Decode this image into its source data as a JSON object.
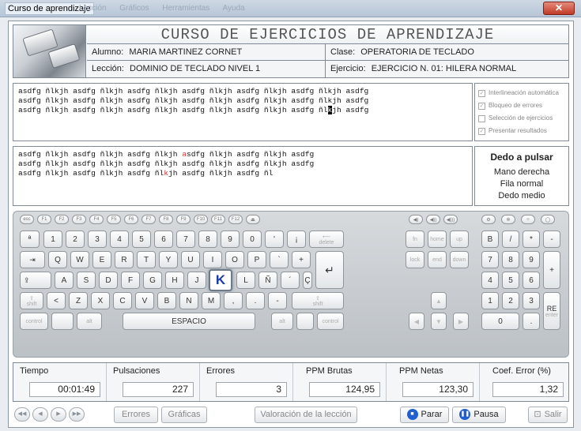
{
  "window": {
    "title": "Curso de aprendizaje",
    "menu_ghost": [
      "Lección",
      "Gráficos",
      "Herramientas",
      "Ayuda"
    ],
    "close_glyph": "✕"
  },
  "header": {
    "course_title": "CURSO DE EJERCICIOS DE APRENDIZAJE",
    "alumno_label": "Alumno:",
    "alumno_value": "MARIA MARTINEZ CORNET",
    "clase_label": "Clase:",
    "clase_value": "OPERATORIA DE TECLADO",
    "leccion_label": "Lección:",
    "leccion_value": "DOMINIO DE TECLADO NIVEL 1",
    "ejercicio_label": "Ejercicio:",
    "ejercicio_value": "EJERCICIO N. 01: HILERA NORMAL"
  },
  "exercise": {
    "lines": [
      "asdfg ñlkjh asdfg ñlkjh asdfg ñlkjh asdfg ñlkjh asdfg ñlkjh asdfg ñlkjh asdfg",
      "asdfg ñlkjh asdfg ñlkjh asdfg ñlkjh asdfg ñlkjh asdfg ñlkjh asdfg ñlkjh asdfg",
      "asdfg ñlkjh asdfg ñlkjh asdfg ñlkjh asdfg ñlkjh asdfg ñlkjh asdfg "
    ],
    "cursor_prefix": "ñl",
    "cursor_char": "k",
    "cursor_suffix": "jh asdfg"
  },
  "typed": {
    "line1_a": "asdfg ñlkjh asdfg ñlkjh asdfg ñlkjh ",
    "line1_err": "a",
    "line1_b": "sdfg ñlkjh asdfg ñlkjh asdfg",
    "line2": "asdfg ñlkjh asdfg ñlkjh asdfg ñlkjh asdfg ñlkjh asdfg ñlkjh asdfg",
    "line3_a": "asdfg ñlkjh asdfg ñlkjh asdfg ñl",
    "line3_err": "k",
    "line3_b": "jh asdfg ñlkjh asdfg ñl"
  },
  "options": [
    {
      "label": "Interlineación automática",
      "checked": true
    },
    {
      "label": "Bloqueo de errores",
      "checked": true
    },
    {
      "label": "Selección de ejercicios",
      "checked": false
    },
    {
      "label": "Presentar resultados",
      "checked": true
    }
  ],
  "hint": {
    "title": "Dedo a pulsar",
    "hand": "Mano derecha",
    "row": "Fila normal",
    "finger": "Dedo medio"
  },
  "keyboard": {
    "fn_row": [
      "esc",
      "F1",
      "F2",
      "F3",
      "F4",
      "F5",
      "F6",
      "F7",
      "F8",
      "F9",
      "F10",
      "F11",
      "F12",
      "⏏"
    ],
    "media_row": [
      "◀)",
      "◀))",
      "◀)))",
      "⚙",
      "✲",
      "☼",
      "◯"
    ],
    "number_row": [
      "ª",
      "1",
      "2",
      "3",
      "4",
      "5",
      "6",
      "7",
      "8",
      "9",
      "0",
      "'",
      "¡"
    ],
    "q_row": [
      "Q",
      "W",
      "E",
      "R",
      "T",
      "Y",
      "U",
      "I",
      "O",
      "P",
      "`",
      "+"
    ],
    "a_row": [
      "A",
      "S",
      "D",
      "F",
      "G",
      "H",
      "J",
      "K",
      "L",
      "Ñ",
      "´",
      "Ç"
    ],
    "z_row": [
      "<",
      "Z",
      "X",
      "C",
      "V",
      "B",
      "N",
      "M",
      ",",
      ".",
      "-"
    ],
    "space_label": "ESPACIO",
    "delete_label": "delete",
    "tab_glyph": "⇥",
    "enter_glyph": "↵",
    "caps_glyph": "⇪",
    "shift_glyph": "⇧",
    "shift_label": "shift",
    "control_label": "control",
    "alt_label": "alt",
    "fn_label": "fn",
    "home_label": "home",
    "up_label": "up",
    "lock_label": "lock",
    "end_label": "end",
    "down_label": "down",
    "up_arrow": "▲",
    "left_arrow": "◀",
    "down_arrow": "▼",
    "right_arrow": "▶",
    "numpad_rows": [
      [
        "B",
        "/",
        "*",
        "-"
      ],
      [
        "7",
        "8",
        "9"
      ],
      [
        "4",
        "5",
        "6"
      ],
      [
        "1",
        "2",
        "3"
      ],
      [
        "0",
        "."
      ]
    ],
    "numpad_plus": "+",
    "numpad_re": "RE",
    "numpad_enter": "enter",
    "active_key": "K"
  },
  "stats": [
    {
      "label": "Tiempo",
      "value": "00:01:49"
    },
    {
      "label": "Pulsaciones",
      "value": "227"
    },
    {
      "label": "Errores",
      "value": "3"
    },
    {
      "label": "PPM Brutas",
      "value": "124,95"
    },
    {
      "label": "PPM Netas",
      "value": "123,30"
    },
    {
      "label": "Coef. Error (%)",
      "value": "1,32"
    }
  ],
  "bottom": {
    "nav_first": "◀◀",
    "nav_prev": "◀",
    "nav_next": "▶",
    "nav_last": "▶▶",
    "errores": "Errores",
    "graficas": "Gráficas",
    "valoracion": "Valoración de la lección",
    "parar": "Parar",
    "pausa": "Pausa",
    "salir": "Salir",
    "stop_glyph": "■",
    "pause_glyph": "❚❚",
    "exit_glyph": "⊡"
  }
}
